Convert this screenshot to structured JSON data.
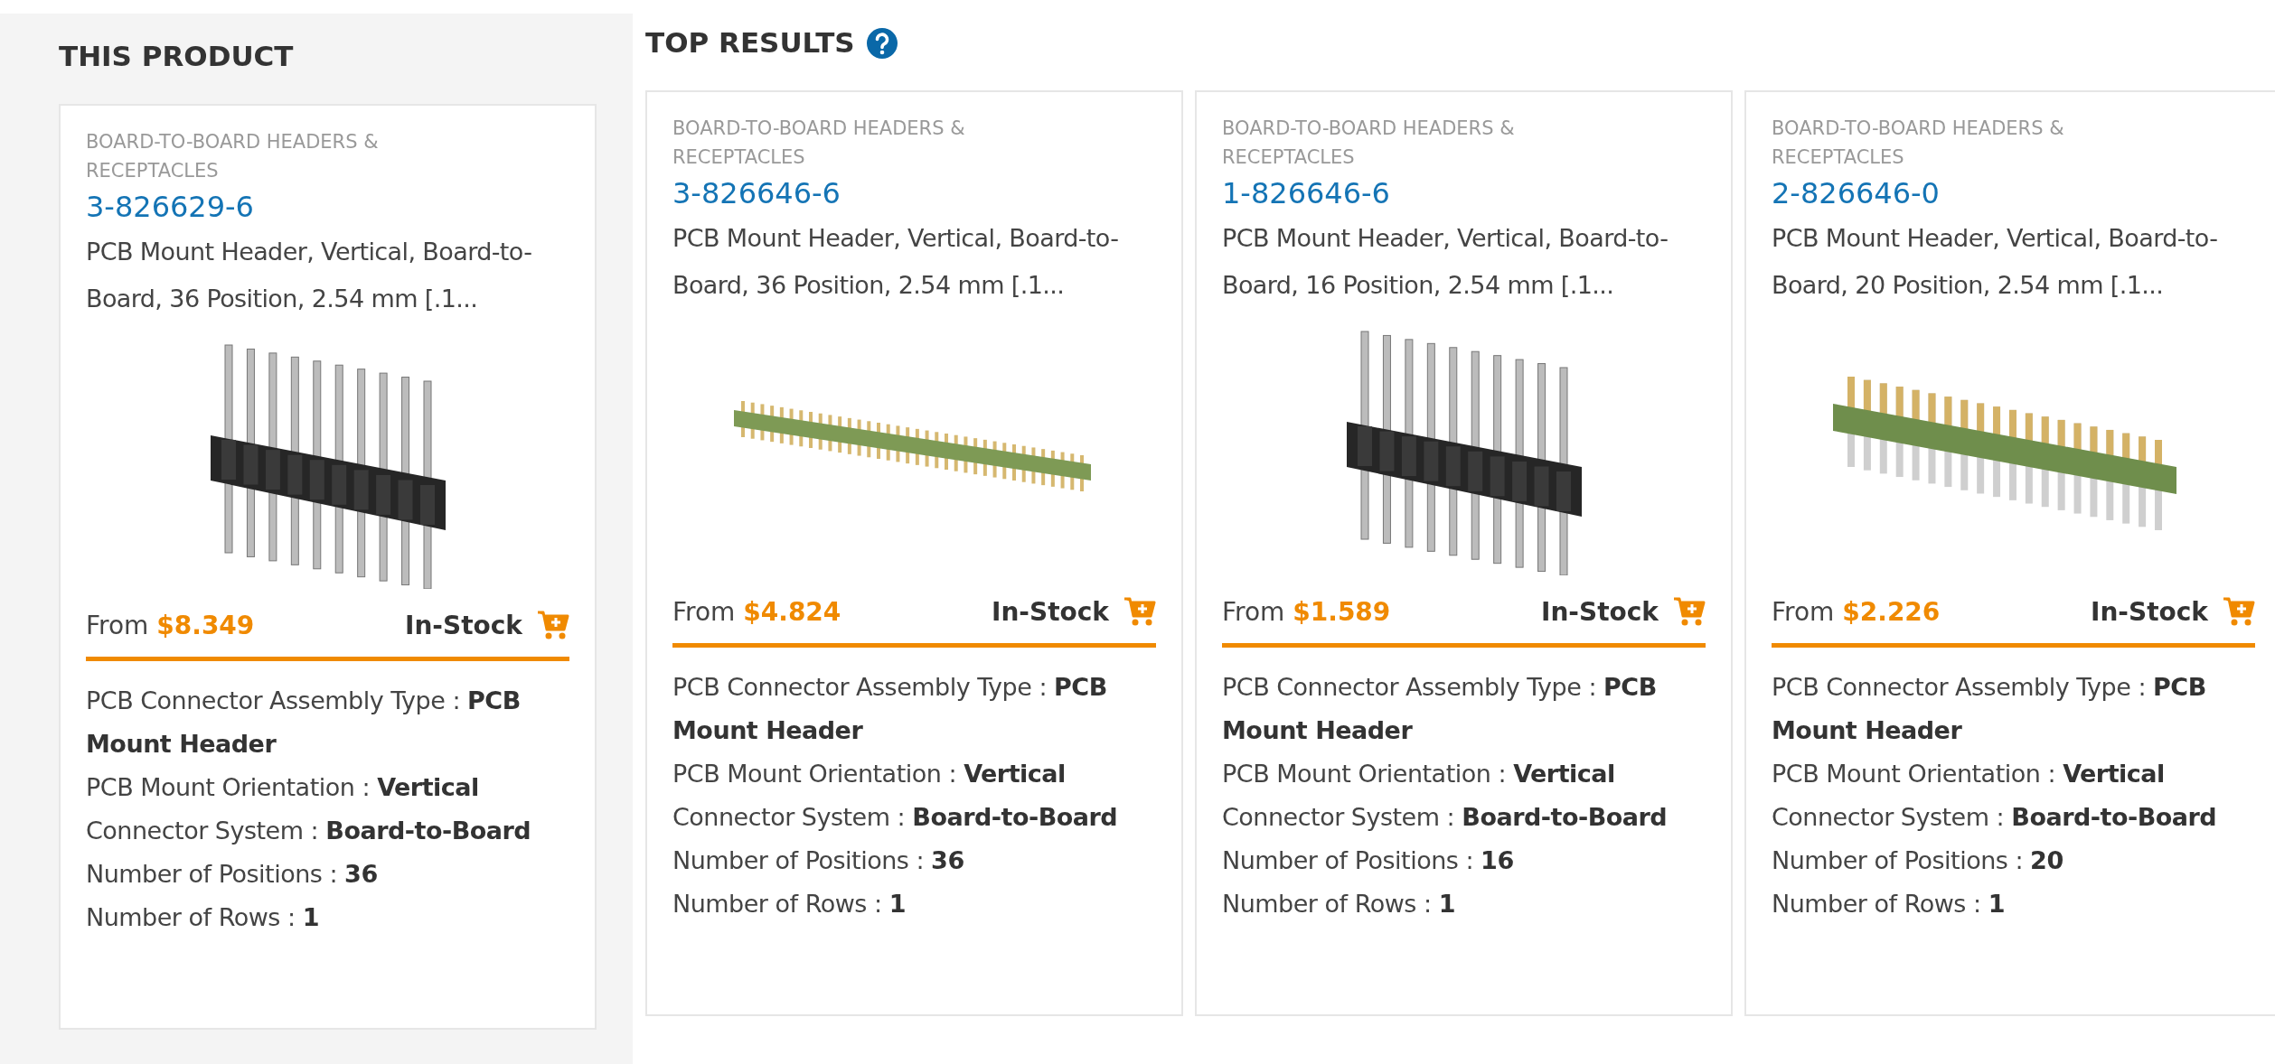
{
  "this_product": {
    "heading": "THIS PRODUCT",
    "card": {
      "category": "BOARD-TO-BOARD HEADERS & RECEPTACLES",
      "part_number": "3-826629-6",
      "description": "PCB Mount Header, Vertical, Board-to-Board, 36 Position, 2.54 mm [.1...",
      "image": {
        "kind": "tall-black"
      },
      "from_label": "From",
      "price": "$8.349",
      "stock": "In-Stock",
      "specs": [
        "PCB Connector Assembly Type : **PCB Mount Header**",
        "PCB Mount Orientation : **Vertical**",
        "Connector System : **Board-to-Board**",
        "Number of Positions : **36**",
        "Number of Rows : **1**"
      ]
    }
  },
  "top_results": {
    "heading": "TOP RESULTS",
    "cards": [
      {
        "category": "BOARD-TO-BOARD HEADERS & RECEPTACLES",
        "part_number": "3-826646-6",
        "description": "PCB Mount Header, Vertical, Board-to-Board, 36 Position, 2.54 mm [.1...",
        "image": {
          "kind": "long-green"
        },
        "from_label": "From",
        "price": "$4.824",
        "stock": "In-Stock",
        "specs": [
          "PCB Connector Assembly Type : **PCB Mount Header**",
          "PCB Mount Orientation : **Vertical**",
          "Connector System : **Board-to-Board**",
          "Number of Positions : **36**",
          "Number of Rows : **1**"
        ]
      },
      {
        "category": "BOARD-TO-BOARD HEADERS & RECEPTACLES",
        "part_number": "1-826646-6",
        "description": "PCB Mount Header, Vertical, Board-to-Board, 16 Position, 2.54 mm [.1...",
        "image": {
          "kind": "tall-black"
        },
        "from_label": "From",
        "price": "$1.589",
        "stock": "In-Stock",
        "specs": [
          "PCB Connector Assembly Type : **PCB Mount Header**",
          "PCB Mount Orientation : **Vertical**",
          "Connector System : **Board-to-Board**",
          "Number of Positions : **16**",
          "Number of Rows : **1**"
        ]
      },
      {
        "category": "BOARD-TO-BOARD HEADERS & RECEPTACLES",
        "part_number": "2-826646-0",
        "description": "PCB Mount Header, Vertical, Board-to-Board, 20 Position, 2.54 mm [.1...",
        "image": {
          "kind": "short-green"
        },
        "from_label": "From",
        "price": "$2.226",
        "stock": "In-Stock",
        "specs": [
          "PCB Connector Assembly Type : **PCB Mount Header**",
          "PCB Mount Orientation : **Vertical**",
          "Connector System : **Board-to-Board**",
          "Number of Positions : **20**",
          "Number of Rows : **1**"
        ]
      }
    ]
  }
}
